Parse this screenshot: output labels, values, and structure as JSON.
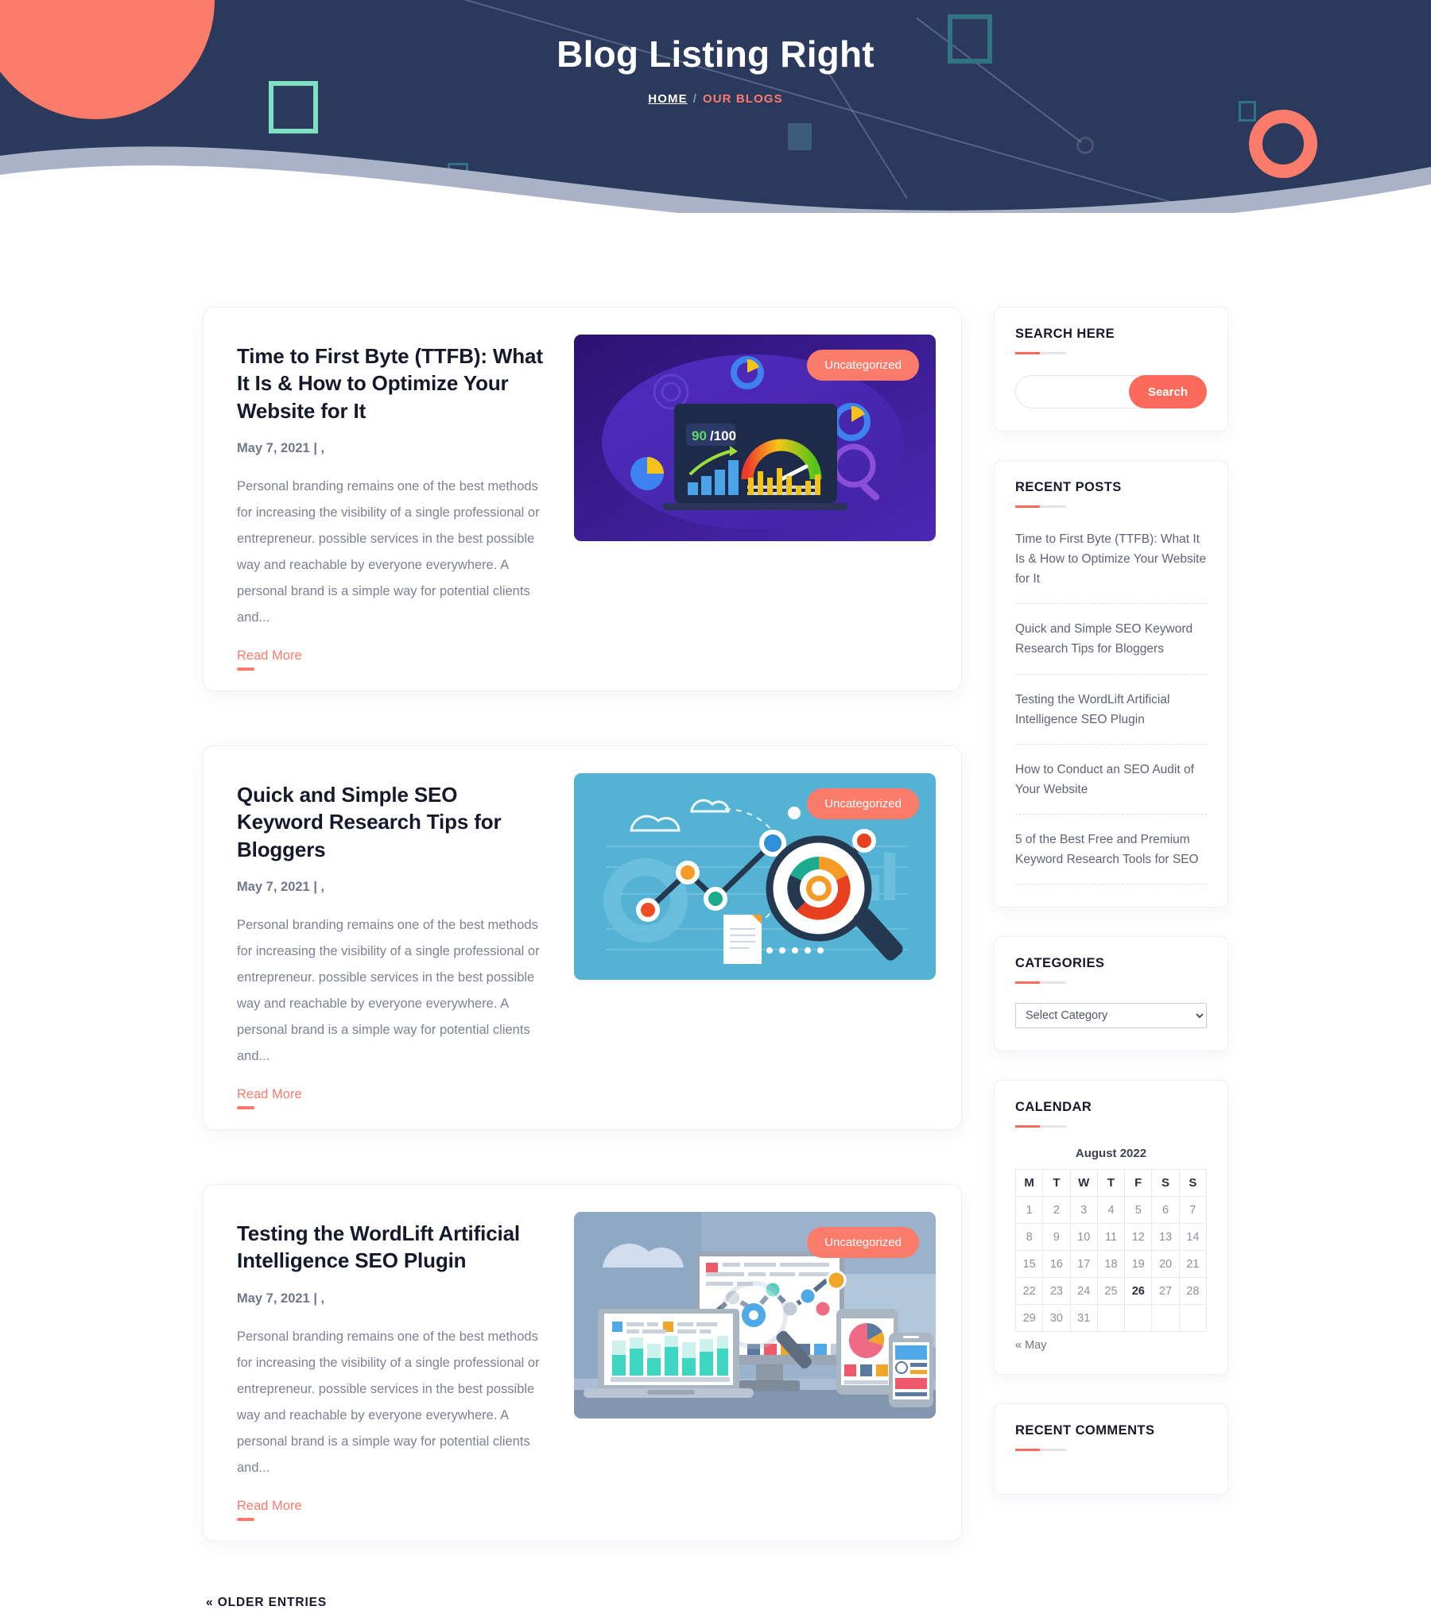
{
  "hero": {
    "title": "Blog Listing Right",
    "breadcrumb": {
      "home": "HOME",
      "separator": "/",
      "current": "OUR BLOGS"
    }
  },
  "colors": {
    "hero_bg": "#2b3a5c",
    "wave_mid": "#a9b2c6",
    "accent": "#fb7b6b",
    "accent_dark": "#fb6b5b",
    "heading": "#14192b",
    "body_text": "#7b8292",
    "meta_text": "#6f7789"
  },
  "posts": [
    {
      "title": "Time to First Byte (TTFB): What It Is & How to Optimize Your Website for It",
      "date": "May 7, 2021 | ,",
      "excerpt": "Personal branding remains one of the best methods for increasing the visibility of a single professional or entrepreneur. possible services in the best possible way and reachable by everyone everywhere. A personal brand is a simple way for potential clients and...",
      "read_more": "Read More",
      "category_badge": "Uncategorized",
      "thumb": {
        "name": "ttfb-speed-score-illustration",
        "score_value": "90",
        "score_total": "/100",
        "bg_from": "#3b1d8c",
        "bg_to": "#4e2bb5"
      }
    },
    {
      "title": "Quick and Simple SEO Keyword Research Tips for Bloggers",
      "date": "May 7, 2021 | ,",
      "excerpt": "Personal branding remains one of the best methods for increasing the visibility of a single professional or entrepreneur. possible services in the best possible way and reachable by everyone everywhere. A personal brand is a simple way for potential clients and...",
      "read_more": "Read More",
      "category_badge": "Uncategorized",
      "thumb": {
        "name": "keyword-research-magnifier-illustration",
        "bg": "#54b3d4"
      }
    },
    {
      "title": "Testing the WordLift Artificial Intelligence SEO Plugin",
      "date": "May 7, 2021 | ,",
      "excerpt": "Personal branding remains one of the best methods for increasing the visibility of a single professional or entrepreneur. possible services in the best possible way and reachable by everyone everywhere. A personal brand is a simple way for potential clients and...",
      "read_more": "Read More",
      "category_badge": "Uncategorized",
      "thumb": {
        "name": "multi-device-analytics-illustration",
        "bg": "#9bb2cc"
      }
    }
  ],
  "pagination": {
    "older_entries": "« OLDER ENTRIES"
  },
  "sidebar": {
    "search": {
      "title": "SEARCH HERE",
      "input_value": "",
      "placeholder": "",
      "button_label": "Search"
    },
    "recent_posts": {
      "title": "RECENT POSTS",
      "items": [
        "Time to First Byte (TTFB): What It Is & How to Optimize Your Website for It",
        "Quick and Simple SEO Keyword Research Tips for Bloggers",
        "Testing the WordLift Artificial Intelligence SEO Plugin",
        "How to Conduct an SEO Audit of Your Website",
        "5 of the Best Free and Premium Keyword Research Tools for SEO"
      ]
    },
    "categories": {
      "title": "CATEGORIES",
      "selected": "Select Category",
      "options": [
        "Select Category"
      ]
    },
    "calendar": {
      "title": "CALENDAR",
      "caption": "August 2022",
      "weekdays": [
        "M",
        "T",
        "W",
        "T",
        "F",
        "S",
        "S"
      ],
      "weeks": [
        [
          "1",
          "2",
          "3",
          "4",
          "5",
          "6",
          "7"
        ],
        [
          "8",
          "9",
          "10",
          "11",
          "12",
          "13",
          "14"
        ],
        [
          "15",
          "16",
          "17",
          "18",
          "19",
          "20",
          "21"
        ],
        [
          "22",
          "23",
          "24",
          "25",
          "26",
          "27",
          "28"
        ],
        [
          "29",
          "30",
          "31",
          "",
          "",
          "",
          ""
        ]
      ],
      "today": "26",
      "prev_link": "« May"
    },
    "recent_comments": {
      "title": "RECENT COMMENTS",
      "items": []
    }
  }
}
